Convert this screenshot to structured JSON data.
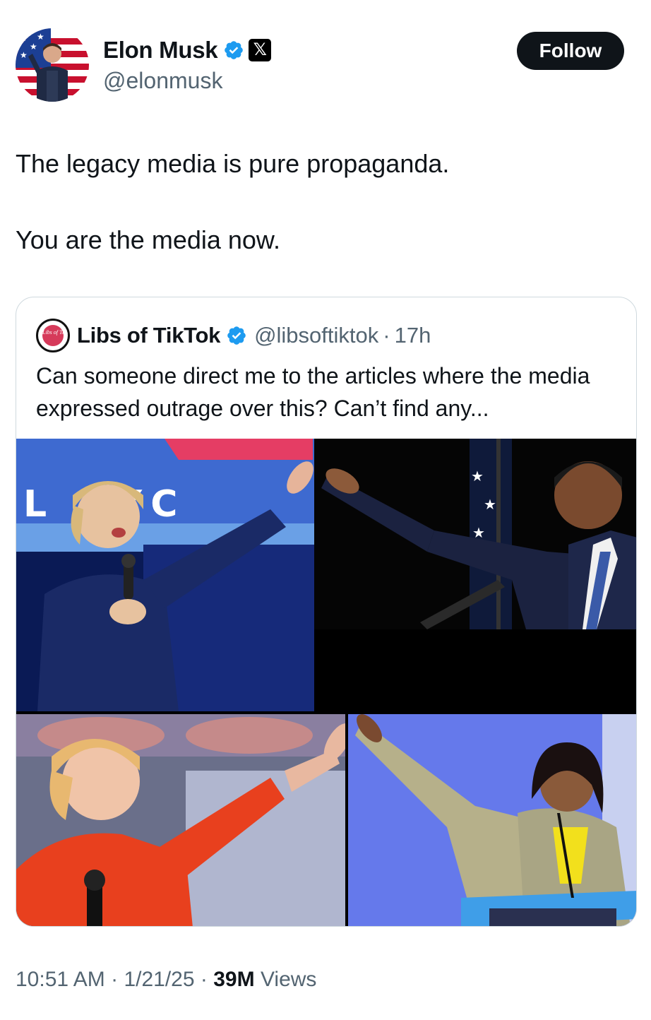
{
  "author": {
    "name": "Elon Musk",
    "handle": "@elonmusk",
    "verified_icon": "verified-badge-icon",
    "affiliate_icon": "x-logo-icon",
    "x_glyph": "𝕏"
  },
  "follow_label": "Follow",
  "tweet": {
    "paragraphs": [
      "The legacy media is pure propaganda.",
      "You are the media now."
    ]
  },
  "quote": {
    "author_name": "Libs of TikTok",
    "author_handle": "@libsoftiktok",
    "separator": "·",
    "time_ago": "17h",
    "avatar_text": "Libs of TikTok",
    "text": "Can someone direct me to the articles where the media expressed outrage over this? Can’t find any...",
    "images": [
      {
        "name": "photo-top-left",
        "sign_text": "L     RYC"
      },
      {
        "name": "photo-top-right"
      },
      {
        "name": "photo-bottom-left"
      },
      {
        "name": "photo-bottom-right"
      }
    ]
  },
  "meta": {
    "time": "10:51 AM",
    "date": "1/21/25",
    "separator": "·",
    "views_count": "39M",
    "views_label": "Views"
  },
  "colors": {
    "accent": "#1d9bf0",
    "text": "#0f1419",
    "muted": "#536471",
    "border": "#cfd9de"
  }
}
